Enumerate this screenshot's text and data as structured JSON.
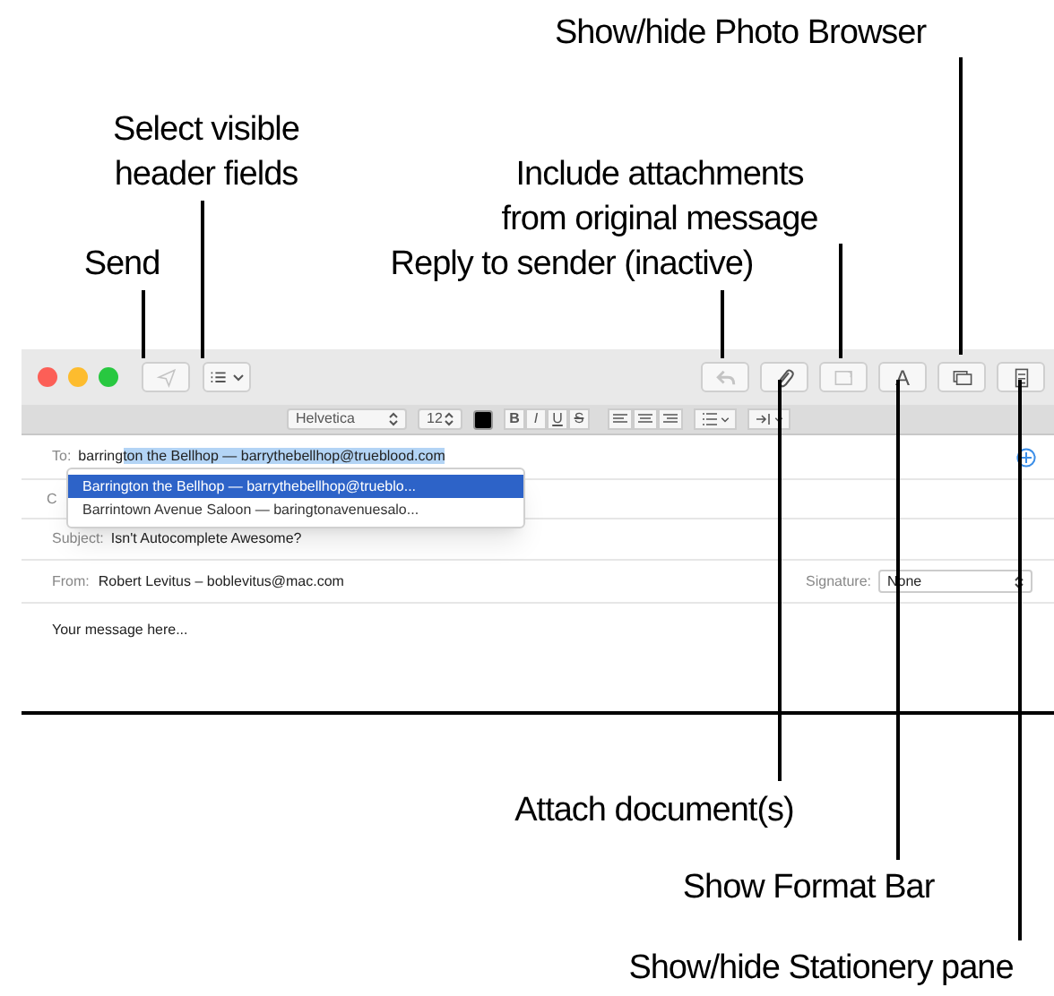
{
  "callouts": [
    {
      "lines": [
        "Show/hide Photo Browser"
      ]
    },
    {
      "lines": [
        "Select visible",
        "header fields"
      ]
    },
    {
      "lines": [
        "Include attachments",
        "from original message"
      ]
    },
    {
      "lines": [
        "Send"
      ]
    },
    {
      "lines": [
        "Reply to sender (inactive)"
      ]
    },
    {
      "lines": [
        "Attach document(s)"
      ]
    },
    {
      "lines": [
        "Show Format Bar"
      ]
    },
    {
      "lines": [
        "Show/hide Stationery pane"
      ]
    }
  ],
  "toolbar": {
    "left": [
      {
        "kind": "send",
        "disabled": true
      },
      {
        "kind": "header_fields",
        "disabled": false
      }
    ],
    "right": [
      {
        "kind": "reply",
        "disabled": true
      },
      {
        "kind": "attach",
        "disabled": false
      },
      {
        "kind": "include",
        "disabled": true
      },
      {
        "kind": "format",
        "label": "A",
        "disabled": false
      },
      {
        "kind": "photo",
        "disabled": false
      },
      {
        "kind": "stationery",
        "disabled": false
      }
    ]
  },
  "format_bar": {
    "font": "Helvetica",
    "size": "12",
    "color": "#000000",
    "styles": [
      "B",
      "I",
      "U",
      "S"
    ]
  },
  "to": {
    "label": "To:",
    "typed": "barring",
    "completion": "ton the Bellhop — barrythebellhop@trueblood.com"
  },
  "suggestions": [
    {
      "text": "Barrington the Bellhop — barrythebellhop@trueblo...",
      "selected": true
    },
    {
      "text": "Barrintown Avenue Saloon — baringtonavenuesalo...",
      "selected": false
    }
  ],
  "cc_label": "C",
  "subject": {
    "label": "Subject:",
    "value": "Isn't Autocomplete Awesome?"
  },
  "from": {
    "label": "From:",
    "value": "Robert Levitus – boblevitus@mac.com"
  },
  "signature": {
    "label": "Signature:",
    "value": "None"
  },
  "body": "Your message here..."
}
